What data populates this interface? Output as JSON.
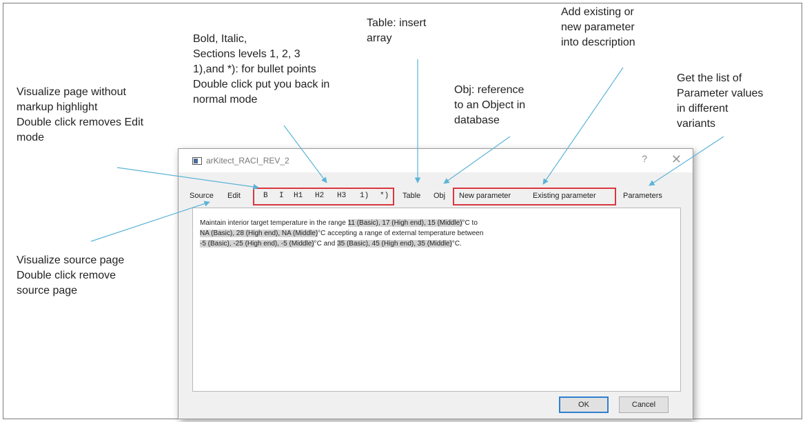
{
  "annotations": {
    "bold": [
      "Bold, Italic,",
      "Sections levels 1, 2, 3",
      "1),and *): for bullet points",
      "Double click put you back in",
      "normal mode"
    ],
    "table": [
      "Table: insert",
      "array"
    ],
    "add_param": [
      "Add existing or",
      "new parameter",
      "into description"
    ],
    "visualize": [
      "Visualize page without",
      "markup highlight",
      "Double click removes Edit",
      "mode"
    ],
    "obj": [
      "Obj: reference",
      "to an Object in",
      "database"
    ],
    "params": [
      "Get the list of",
      "Parameter values",
      "in different",
      "variants"
    ],
    "source": [
      "Visualize source page",
      "Double click remove",
      "source page"
    ]
  },
  "dialog": {
    "title": "arKitect_RACI_REV_2",
    "help": "?",
    "close": "✕"
  },
  "toolbar": {
    "source": "Source",
    "edit": "Edit",
    "bold": "B",
    "italic": "I",
    "h1": "H1",
    "h2": "H2",
    "h3": "H3",
    "numbered": "1)",
    "bullet": "*)",
    "table": "Table",
    "obj": "Obj",
    "new_param": "New parameter",
    "existing_param": "Existing parameter",
    "parameters": "Parameters"
  },
  "editor": {
    "line1_a": "Maintain interior target temperature in the range ",
    "line1_hl": "11 (Basic), 17 (High end), 15 (Middle)",
    "line1_b": "°C to",
    "line2_hl": "NA (Basic), 28 (High end), NA (Middle)",
    "line2_b": "°C accepting a range of external temperature between",
    "line3_hl1": "-5 (Basic), -25 (High end), -5 (Middle)",
    "line3_mid": "°C and ",
    "line3_hl2": "35 (Basic), 45 (High end), 35 (Middle)",
    "line3_end": "°C."
  },
  "buttons": {
    "ok": "OK",
    "cancel": "Cancel"
  },
  "colors": {
    "annotation_arrow": "#5ab4d6",
    "group_border": "#d9363e",
    "highlight": "#d4d4d4",
    "ok_border": "#2f7fd0"
  }
}
